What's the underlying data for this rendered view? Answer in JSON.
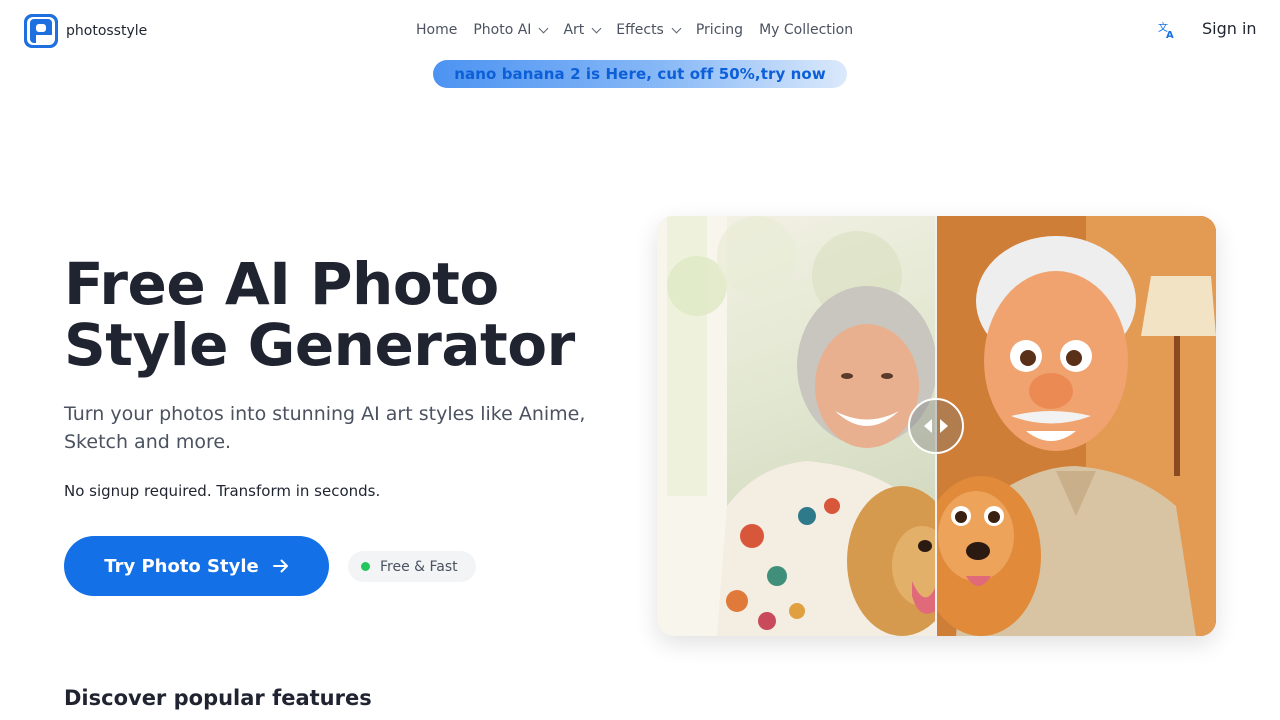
{
  "brand": {
    "name": "photosstyle",
    "accent": "#1370e6"
  },
  "nav": {
    "items": [
      {
        "label": "Home",
        "has_dropdown": false
      },
      {
        "label": "Photo AI",
        "has_dropdown": true
      },
      {
        "label": "Art",
        "has_dropdown": true
      },
      {
        "label": "Effects",
        "has_dropdown": true
      },
      {
        "label": "Pricing",
        "has_dropdown": false
      },
      {
        "label": "My Collection",
        "has_dropdown": false
      }
    ],
    "language_icon": "translate-icon",
    "signin_label": "Sign in"
  },
  "promo": {
    "text": "nano banana 2 is Here, cut off 50%,try now"
  },
  "hero": {
    "title": "Free AI Photo Style Generator",
    "subtitle": "Turn your photos into stunning AI art styles like Anime, Sketch and more.",
    "note": "No signup required. Transform in seconds.",
    "cta_label": "Try Photo Style",
    "badge_label": "Free & Fast",
    "badge_color": "#22c55e"
  },
  "compare": {
    "before_alt": "Photo of a smiling elderly woman with a golden retriever",
    "after_alt": "Cartoon-style version of an elderly man with a golden retriever",
    "slider_position": 0.5
  },
  "features": {
    "title": "Discover popular features"
  }
}
